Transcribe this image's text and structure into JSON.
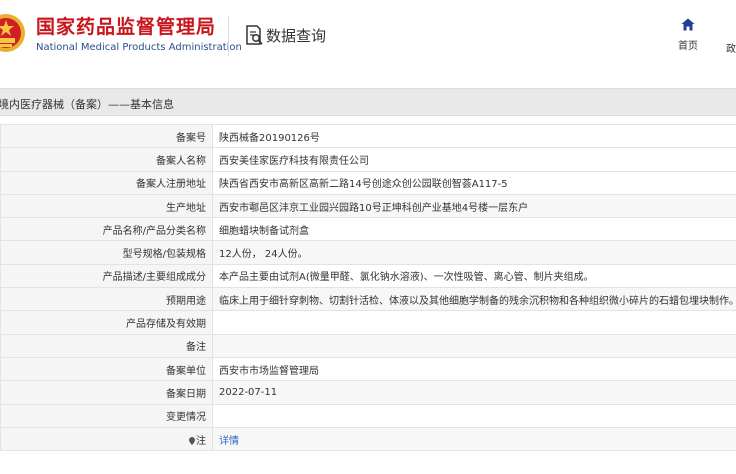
{
  "header": {
    "site_name_cn": "国家药品监督管理局",
    "site_name_en": "National Medical Products Administration",
    "page_name": "数据查询",
    "nav_home": "首页",
    "nav_partial": "政"
  },
  "section": {
    "title": "境内医疗器械（备案）——基本信息"
  },
  "rows": [
    {
      "label": "备案号",
      "value": "陕西械备20190126号"
    },
    {
      "label": "备案人名称",
      "value": "西安美佳家医疗科技有限责任公司"
    },
    {
      "label": "备案人注册地址",
      "value": "陕西省西安市高新区高新二路14号创途众创公园联创智荟A117-5"
    },
    {
      "label": "生产地址",
      "value": "西安市鄠邑区沣京工业园兴园路10号正坤科创产业基地4号楼一层东户"
    },
    {
      "label": "产品名称/产品分类名称",
      "value": "细胞蜡块制备试剂盒"
    },
    {
      "label": "型号规格/包装规格",
      "value": "12人份， 24人份。"
    },
    {
      "label": "产品描述/主要组成成分",
      "value": "本产品主要由试剂A(微量甲醛、氯化钠水溶液)、一次性吸管、离心管、制片夹组成。"
    },
    {
      "label": "预期用途",
      "value": "临床上用于细针穿刺物、切割针活检、体液以及其他细胞学制备的残余沉积物和各种组织微小碎片的石蜡包埋块制作。"
    },
    {
      "label": "产品存储及有效期",
      "value": ""
    },
    {
      "label": "备注",
      "value": ""
    },
    {
      "label": "备案单位",
      "value": "西安市市场监督管理局"
    },
    {
      "label": "备案日期",
      "value": "2022-07-11"
    },
    {
      "label": "变更情况",
      "value": ""
    }
  ],
  "note_row": {
    "label": "注",
    "link": "详情"
  },
  "colors": {
    "brand_red": "#c8161d",
    "brand_blue": "#2b4d8f",
    "link_blue": "#2a66c8"
  }
}
